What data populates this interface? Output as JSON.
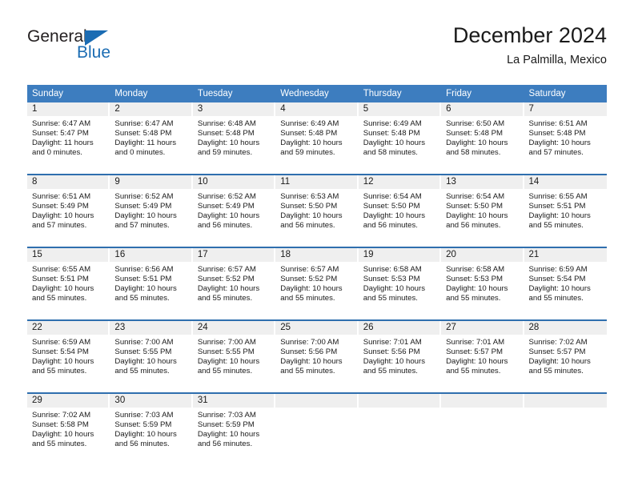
{
  "logo": {
    "word_one": "General",
    "word_two": "Blue",
    "triangle_icon": "triangle-icon",
    "brand_color": "#1b6cb3"
  },
  "header": {
    "title": "December 2024",
    "subtitle": "La Palmilla, Mexico"
  },
  "theme": {
    "header_blue": "#3d7dbf",
    "separator_blue": "#2f6fae",
    "day_band_gray": "#efefef"
  },
  "weekdays": [
    "Sunday",
    "Monday",
    "Tuesday",
    "Wednesday",
    "Thursday",
    "Friday",
    "Saturday"
  ],
  "weeks": [
    [
      {
        "day": "1",
        "sunrise": "Sunrise: 6:47 AM",
        "sunset": "Sunset: 5:47 PM",
        "daylight_1": "Daylight: 11 hours",
        "daylight_2": "and 0 minutes."
      },
      {
        "day": "2",
        "sunrise": "Sunrise: 6:47 AM",
        "sunset": "Sunset: 5:48 PM",
        "daylight_1": "Daylight: 11 hours",
        "daylight_2": "and 0 minutes."
      },
      {
        "day": "3",
        "sunrise": "Sunrise: 6:48 AM",
        "sunset": "Sunset: 5:48 PM",
        "daylight_1": "Daylight: 10 hours",
        "daylight_2": "and 59 minutes."
      },
      {
        "day": "4",
        "sunrise": "Sunrise: 6:49 AM",
        "sunset": "Sunset: 5:48 PM",
        "daylight_1": "Daylight: 10 hours",
        "daylight_2": "and 59 minutes."
      },
      {
        "day": "5",
        "sunrise": "Sunrise: 6:49 AM",
        "sunset": "Sunset: 5:48 PM",
        "daylight_1": "Daylight: 10 hours",
        "daylight_2": "and 58 minutes."
      },
      {
        "day": "6",
        "sunrise": "Sunrise: 6:50 AM",
        "sunset": "Sunset: 5:48 PM",
        "daylight_1": "Daylight: 10 hours",
        "daylight_2": "and 58 minutes."
      },
      {
        "day": "7",
        "sunrise": "Sunrise: 6:51 AM",
        "sunset": "Sunset: 5:48 PM",
        "daylight_1": "Daylight: 10 hours",
        "daylight_2": "and 57 minutes."
      }
    ],
    [
      {
        "day": "8",
        "sunrise": "Sunrise: 6:51 AM",
        "sunset": "Sunset: 5:49 PM",
        "daylight_1": "Daylight: 10 hours",
        "daylight_2": "and 57 minutes."
      },
      {
        "day": "9",
        "sunrise": "Sunrise: 6:52 AM",
        "sunset": "Sunset: 5:49 PM",
        "daylight_1": "Daylight: 10 hours",
        "daylight_2": "and 57 minutes."
      },
      {
        "day": "10",
        "sunrise": "Sunrise: 6:52 AM",
        "sunset": "Sunset: 5:49 PM",
        "daylight_1": "Daylight: 10 hours",
        "daylight_2": "and 56 minutes."
      },
      {
        "day": "11",
        "sunrise": "Sunrise: 6:53 AM",
        "sunset": "Sunset: 5:50 PM",
        "daylight_1": "Daylight: 10 hours",
        "daylight_2": "and 56 minutes."
      },
      {
        "day": "12",
        "sunrise": "Sunrise: 6:54 AM",
        "sunset": "Sunset: 5:50 PM",
        "daylight_1": "Daylight: 10 hours",
        "daylight_2": "and 56 minutes."
      },
      {
        "day": "13",
        "sunrise": "Sunrise: 6:54 AM",
        "sunset": "Sunset: 5:50 PM",
        "daylight_1": "Daylight: 10 hours",
        "daylight_2": "and 56 minutes."
      },
      {
        "day": "14",
        "sunrise": "Sunrise: 6:55 AM",
        "sunset": "Sunset: 5:51 PM",
        "daylight_1": "Daylight: 10 hours",
        "daylight_2": "and 55 minutes."
      }
    ],
    [
      {
        "day": "15",
        "sunrise": "Sunrise: 6:55 AM",
        "sunset": "Sunset: 5:51 PM",
        "daylight_1": "Daylight: 10 hours",
        "daylight_2": "and 55 minutes."
      },
      {
        "day": "16",
        "sunrise": "Sunrise: 6:56 AM",
        "sunset": "Sunset: 5:51 PM",
        "daylight_1": "Daylight: 10 hours",
        "daylight_2": "and 55 minutes."
      },
      {
        "day": "17",
        "sunrise": "Sunrise: 6:57 AM",
        "sunset": "Sunset: 5:52 PM",
        "daylight_1": "Daylight: 10 hours",
        "daylight_2": "and 55 minutes."
      },
      {
        "day": "18",
        "sunrise": "Sunrise: 6:57 AM",
        "sunset": "Sunset: 5:52 PM",
        "daylight_1": "Daylight: 10 hours",
        "daylight_2": "and 55 minutes."
      },
      {
        "day": "19",
        "sunrise": "Sunrise: 6:58 AM",
        "sunset": "Sunset: 5:53 PM",
        "daylight_1": "Daylight: 10 hours",
        "daylight_2": "and 55 minutes."
      },
      {
        "day": "20",
        "sunrise": "Sunrise: 6:58 AM",
        "sunset": "Sunset: 5:53 PM",
        "daylight_1": "Daylight: 10 hours",
        "daylight_2": "and 55 minutes."
      },
      {
        "day": "21",
        "sunrise": "Sunrise: 6:59 AM",
        "sunset": "Sunset: 5:54 PM",
        "daylight_1": "Daylight: 10 hours",
        "daylight_2": "and 55 minutes."
      }
    ],
    [
      {
        "day": "22",
        "sunrise": "Sunrise: 6:59 AM",
        "sunset": "Sunset: 5:54 PM",
        "daylight_1": "Daylight: 10 hours",
        "daylight_2": "and 55 minutes."
      },
      {
        "day": "23",
        "sunrise": "Sunrise: 7:00 AM",
        "sunset": "Sunset: 5:55 PM",
        "daylight_1": "Daylight: 10 hours",
        "daylight_2": "and 55 minutes."
      },
      {
        "day": "24",
        "sunrise": "Sunrise: 7:00 AM",
        "sunset": "Sunset: 5:55 PM",
        "daylight_1": "Daylight: 10 hours",
        "daylight_2": "and 55 minutes."
      },
      {
        "day": "25",
        "sunrise": "Sunrise: 7:00 AM",
        "sunset": "Sunset: 5:56 PM",
        "daylight_1": "Daylight: 10 hours",
        "daylight_2": "and 55 minutes."
      },
      {
        "day": "26",
        "sunrise": "Sunrise: 7:01 AM",
        "sunset": "Sunset: 5:56 PM",
        "daylight_1": "Daylight: 10 hours",
        "daylight_2": "and 55 minutes."
      },
      {
        "day": "27",
        "sunrise": "Sunrise: 7:01 AM",
        "sunset": "Sunset: 5:57 PM",
        "daylight_1": "Daylight: 10 hours",
        "daylight_2": "and 55 minutes."
      },
      {
        "day": "28",
        "sunrise": "Sunrise: 7:02 AM",
        "sunset": "Sunset: 5:57 PM",
        "daylight_1": "Daylight: 10 hours",
        "daylight_2": "and 55 minutes."
      }
    ],
    [
      {
        "day": "29",
        "sunrise": "Sunrise: 7:02 AM",
        "sunset": "Sunset: 5:58 PM",
        "daylight_1": "Daylight: 10 hours",
        "daylight_2": "and 55 minutes."
      },
      {
        "day": "30",
        "sunrise": "Sunrise: 7:03 AM",
        "sunset": "Sunset: 5:59 PM",
        "daylight_1": "Daylight: 10 hours",
        "daylight_2": "and 56 minutes."
      },
      {
        "day": "31",
        "sunrise": "Sunrise: 7:03 AM",
        "sunset": "Sunset: 5:59 PM",
        "daylight_1": "Daylight: 10 hours",
        "daylight_2": "and 56 minutes."
      },
      {
        "day": "",
        "sunrise": "",
        "sunset": "",
        "daylight_1": "",
        "daylight_2": ""
      },
      {
        "day": "",
        "sunrise": "",
        "sunset": "",
        "daylight_1": "",
        "daylight_2": ""
      },
      {
        "day": "",
        "sunrise": "",
        "sunset": "",
        "daylight_1": "",
        "daylight_2": ""
      },
      {
        "day": "",
        "sunrise": "",
        "sunset": "",
        "daylight_1": "",
        "daylight_2": ""
      }
    ]
  ]
}
